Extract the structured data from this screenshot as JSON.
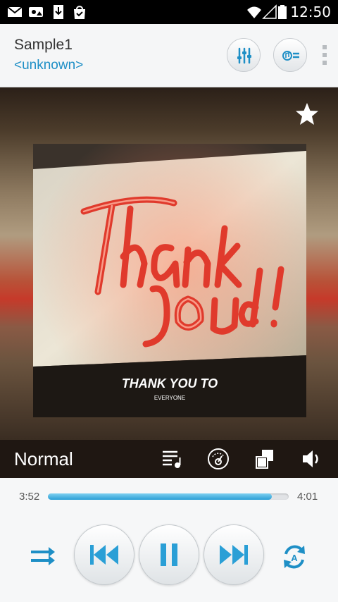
{
  "status_bar": {
    "time": "12:50",
    "icons": [
      "gmail-icon",
      "photo-notification-icon",
      "download-icon",
      "shopping-bag-icon",
      "wifi-icon",
      "signal-icon",
      "battery-icon"
    ]
  },
  "header": {
    "title": "Sample1",
    "artist": "<unknown>",
    "buttons": [
      "equalizer-icon",
      "playlist-icon",
      "overflow-menu-icon"
    ]
  },
  "album": {
    "cover_text_main": "THANK YOU TO",
    "cover_text_sub": "EVERYONE",
    "neon_sign": "Thank you!",
    "favorite": "star-icon"
  },
  "mode_bar": {
    "label": "Normal",
    "icons": [
      "queue-icon",
      "sound-effect-icon",
      "mini-player-icon",
      "volume-icon"
    ]
  },
  "progress": {
    "elapsed": "3:52",
    "total": "4:01",
    "fraction": 0.93
  },
  "controls": {
    "icons": [
      "shuffle-icon",
      "previous-icon",
      "pause-icon",
      "next-icon",
      "repeat-all-icon"
    ]
  },
  "colors": {
    "accent": "#2a9fd6",
    "link": "#1e8fc6",
    "neon": "#e03a2c"
  }
}
